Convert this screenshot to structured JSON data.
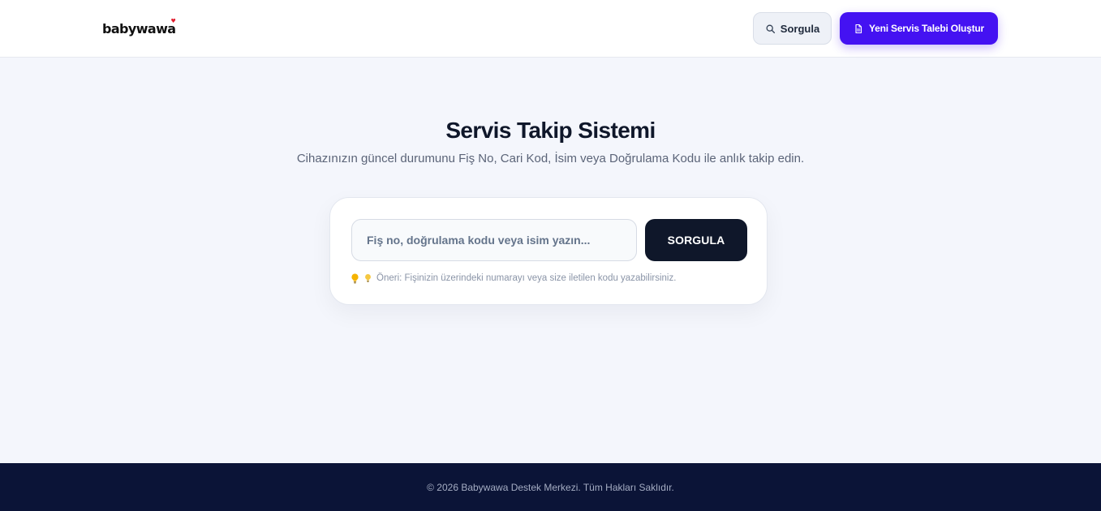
{
  "header": {
    "logo_text": "babywawa",
    "query_button_label": "Sorgula",
    "new_request_button_label": "Yeni Servis Talebi Oluştur"
  },
  "main": {
    "title": "Servis Takip Sistemi",
    "subtitle": "Cihazınızın güncel durumunu Fiş No, Cari Kod, İsim veya Doğrulama Kodu ile anlık takip edin.",
    "search": {
      "value": "",
      "placeholder": "Fiş no, doğrulama kodu veya isim yazın...",
      "submit_label": "SORGULA"
    },
    "hint_text": "Öneri: Fişinizin üzerindeki numarayı veya size iletilen kodu yazabilirsiniz."
  },
  "footer": {
    "copyright": "© 2026 Babywawa Destek Merkezi. Tüm Hakları Saklıdır."
  },
  "icons": {
    "query": "search-icon",
    "new_request": "document-icon",
    "hint": "lightbulb-icon"
  },
  "colors": {
    "brand_primary": "#4412f2",
    "submit_dark": "#0f172a",
    "footer_bg": "#0b1437",
    "page_bg": "#f4f6fc",
    "hint_icon": "#f5b301",
    "logo_heart": "#e11d2e"
  }
}
